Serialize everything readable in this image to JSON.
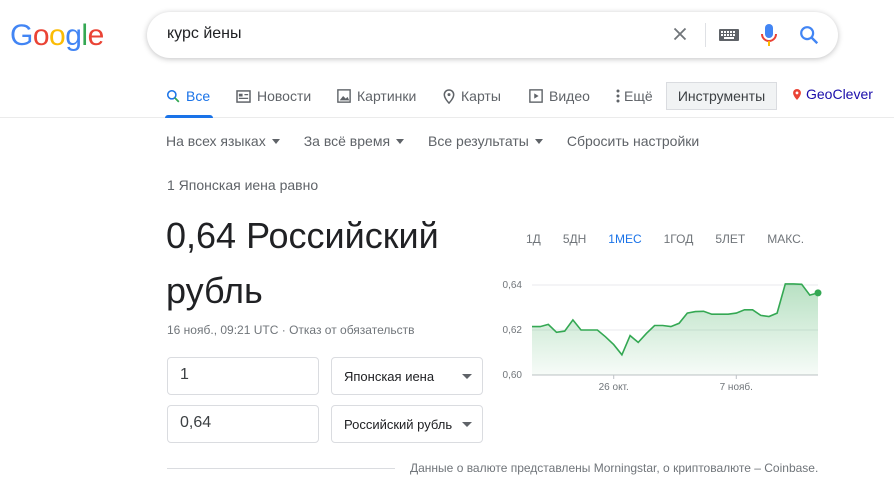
{
  "logo": {
    "text": "Google",
    "letters": [
      "G",
      "o",
      "o",
      "g",
      "l",
      "e"
    ],
    "colors": [
      "#4285f4",
      "#ea4335",
      "#fbbc05",
      "#4285f4",
      "#34a853",
      "#ea4335"
    ]
  },
  "search": {
    "query": "курс йены"
  },
  "tabs": [
    {
      "label": "Все",
      "icon": "search-icon",
      "active": true
    },
    {
      "label": "Новости",
      "icon": "news-icon"
    },
    {
      "label": "Картинки",
      "icon": "image-icon"
    },
    {
      "label": "Карты",
      "icon": "map-pin-icon"
    },
    {
      "label": "Видео",
      "icon": "video-icon"
    },
    {
      "label": "Ещё",
      "icon": "more-vert-icon"
    }
  ],
  "tools_button": "Инструменты",
  "geoclever": "GeoClever",
  "tools_row": {
    "language": "На всех языках",
    "time": "За всё время",
    "results": "Все результаты",
    "reset": "Сбросить настройки"
  },
  "converter": {
    "equals_text": "1 Японская иена равно",
    "result_line1": "0,64 Российский",
    "result_line2": "рубль",
    "timestamp": "16 нояб., 09:21 UTC",
    "disclaimer": "Отказ от обязательств",
    "from_amount": "1",
    "from_currency": "Японская иена",
    "to_amount": "0,64",
    "to_currency": "Российский рубль"
  },
  "chart_ranges": [
    "1Д",
    "5ДН",
    "1МЕС",
    "1ГОД",
    "5ЛЕТ",
    "МАКС."
  ],
  "chart_active_range": "1МЕС",
  "chart_data": {
    "type": "area",
    "yticks": [
      "0,64",
      "0,62",
      "0,60"
    ],
    "xticks": [
      "26 окт.",
      "7 нояб."
    ],
    "ylim": [
      0.6,
      0.64
    ],
    "grid": true,
    "line_color": "#34a853",
    "values": [
      0.6215,
      0.6215,
      0.6225,
      0.619,
      0.6195,
      0.6245,
      0.62,
      0.62,
      0.62,
      0.617,
      0.6135,
      0.609,
      0.6175,
      0.6145,
      0.6185,
      0.622,
      0.622,
      0.6215,
      0.623,
      0.6275,
      0.6282,
      0.6283,
      0.627,
      0.627,
      0.627,
      0.6275,
      0.629,
      0.629,
      0.6265,
      0.626,
      0.6275,
      0.6405,
      0.6405,
      0.6403,
      0.6355,
      0.6365
    ],
    "x_tick_index": [
      10,
      25
    ]
  },
  "source_text": "Данные о валюте представлены Morningstar, о криптовалюте – Coinbase."
}
